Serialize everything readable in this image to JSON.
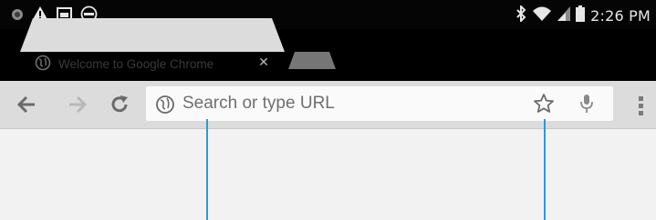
{
  "status_bar": {
    "time": "2:26 PM",
    "left_icons": [
      "app-notification-icon",
      "warning-icon",
      "screenshot-icon",
      "dell-logo-icon"
    ],
    "right_icons": [
      "bluetooth-icon",
      "wifi-icon",
      "cellular-signal-icon",
      "battery-icon"
    ]
  },
  "tabs": [
    {
      "title": "Welcome to Google Chrome",
      "icon": "globe-icon",
      "active": true
    }
  ],
  "toolbar": {
    "icons": [
      "back-arrow-icon",
      "forward-arrow-icon",
      "reload-icon",
      "star-icon",
      "microphone-icon",
      "overflow-menu-icon"
    ]
  },
  "omnibox": {
    "placeholder": "Search or type URL",
    "value": ""
  },
  "colors": {
    "status_bar_bg": "#050505",
    "tab_strip_bg": "#000000",
    "toolbar_bg": "#dcdcdc",
    "omnibox_bg": "#fafafa",
    "callout_line": "#2a9bd6"
  }
}
